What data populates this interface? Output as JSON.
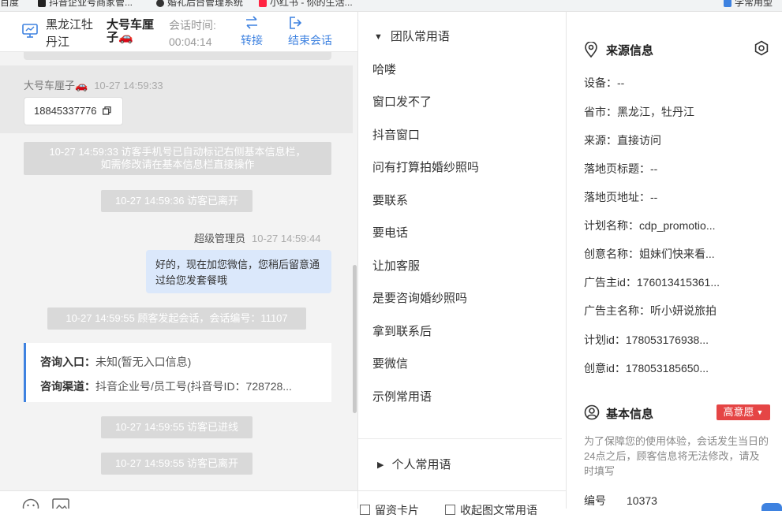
{
  "bookmarks": [
    {
      "label": "百度",
      "color": "#2f6fe4"
    },
    {
      "label": "抖音企业号商家管...",
      "color": "#222222"
    },
    {
      "label": "婚礼后台管理系统",
      "color": "#333333"
    },
    {
      "label": "小红书 - 你的生活...",
      "color": "#ff2442"
    },
    {
      "label": "学常用型",
      "color": "#3e82e0"
    }
  ],
  "chat_header": {
    "visitor_location": "黑龙江牡丹江",
    "visitor_name": "大号车厘子🚗",
    "session_time_label": "会话时间:",
    "session_time_value": "00:04:14",
    "transfer_label": "转接",
    "end_session_label": "结束会话"
  },
  "messages": {
    "visitor_name": "大号车厘子🚗",
    "visitor_time": "10-27 14:59:33",
    "phone_number": "18845337776",
    "sys_auto_mark_line1": "10-27 14:59:33 访客手机号已自动标记右侧基本信息栏，",
    "sys_auto_mark_line2": "如需修改请在基本信息栏直接操作",
    "sys_left_1": "10-27 14:59:36 访客已离开",
    "agent_name": "超级管理员",
    "agent_time": "10-27 14:59:44",
    "agent_text": "好的，现在加您微信，您稍后留意通过给您发套餐哦",
    "sys_session_start": "10-27 14:59:55 顾客发起会话，会话编号：11107",
    "entry_label": "咨询入口：",
    "entry_value": "未知(暂无入口信息)",
    "channel_label": "咨询渠道：",
    "channel_value": "抖音企业号/员工号(抖音号ID：728728...",
    "sys_entered": "10-27 14:59:55 访客已进线",
    "sys_left_2": "10-27 14:59:55 访客已离开"
  },
  "chat_toolbar": {
    "emoji_icon": "smile-icon",
    "image_icon": "image-icon"
  },
  "quick_replies": {
    "team_group_label": "团队常用语",
    "items": [
      "哈喽",
      "窗口发不了",
      "抖音窗口",
      "问有打算拍婚纱照吗",
      "要联系",
      "要电话",
      "让加客服",
      "是要咨询婚纱照吗",
      "拿到联系后",
      "要微信",
      "示例常用语"
    ],
    "personal_group_label": "个人常用语",
    "footer_left": "留资卡片",
    "footer_right": "收起图文常用语"
  },
  "source_info": {
    "title": "来源信息",
    "rows": [
      "设备：--",
      "省市：黑龙江，牡丹江",
      "来源：直接访问",
      "落地页标题：--",
      "落地页地址：--",
      "计划名称：cdp_promotio...",
      "创意名称：姐妹们快来看...",
      "广告主id：176013415361...",
      "广告主名称：听小妍说旅拍",
      "计划id：178053176938...",
      "创意id：178053185650..."
    ]
  },
  "basic_info": {
    "title": "基本信息",
    "intent_tag": "高意愿",
    "notice": "为了保障您的使用体验，会话发生当日的24点之后，顾客信息将无法修改，请及时填写",
    "id_label": "编号",
    "id_value": "10373"
  }
}
